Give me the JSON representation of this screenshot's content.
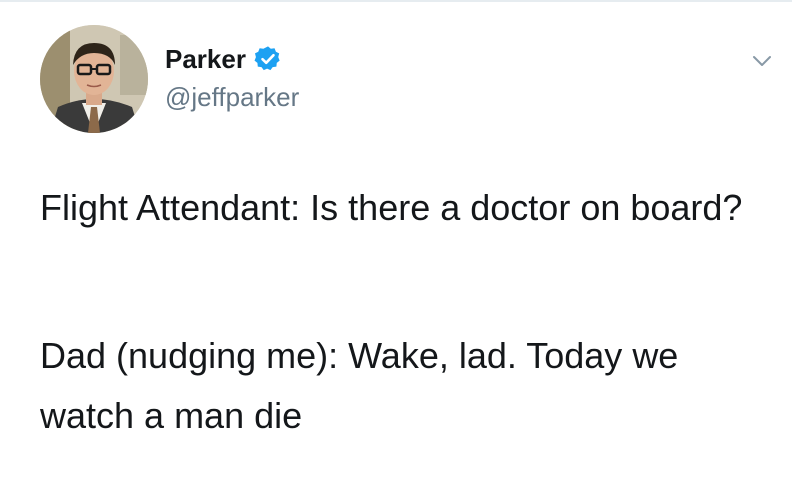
{
  "tweet": {
    "display_name": "Parker",
    "handle": "@jeffparker",
    "verified": true,
    "paragraphs": [
      "Flight Attendant: Is there a doctor on board?",
      "Dad (nudging me): Wake, lad. Today we watch a man die"
    ]
  },
  "icons": {
    "verified": "verified-badge-icon",
    "menu": "chevron-down-icon",
    "avatar": "avatar-photo"
  },
  "colors": {
    "verified_blue": "#1da1f2",
    "handle_gray": "#657786",
    "text": "#14171a"
  }
}
